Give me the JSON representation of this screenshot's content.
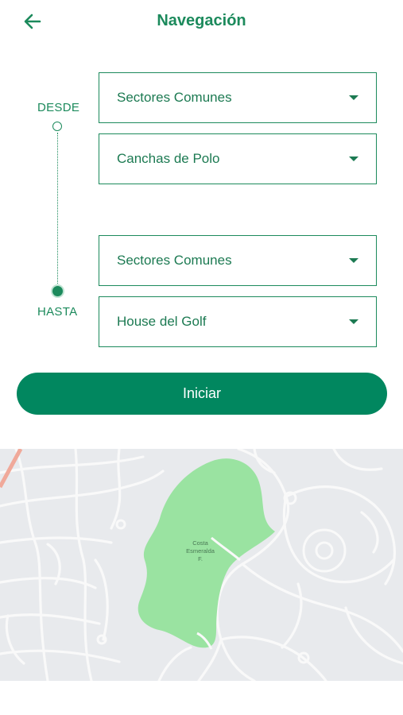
{
  "header": {
    "title": "Navegación",
    "back_icon": "arrow-left-icon"
  },
  "route": {
    "from_label": "DESDE",
    "to_label": "HASTA"
  },
  "selects": {
    "from_sector": "Sectores Comunes",
    "from_place": "Canchas de Polo",
    "to_sector": "Sectores Comunes",
    "to_place": "House del Golf"
  },
  "actions": {
    "start_label": "Iniciar"
  },
  "map": {
    "poi_line1": "Costa",
    "poi_line2": "Esmeralda",
    "poi_line3": "F."
  },
  "colors": {
    "accent": "#1c8a5c",
    "button": "#01875f",
    "map_bg": "#e8eaed",
    "park": "#9ae3a1"
  }
}
